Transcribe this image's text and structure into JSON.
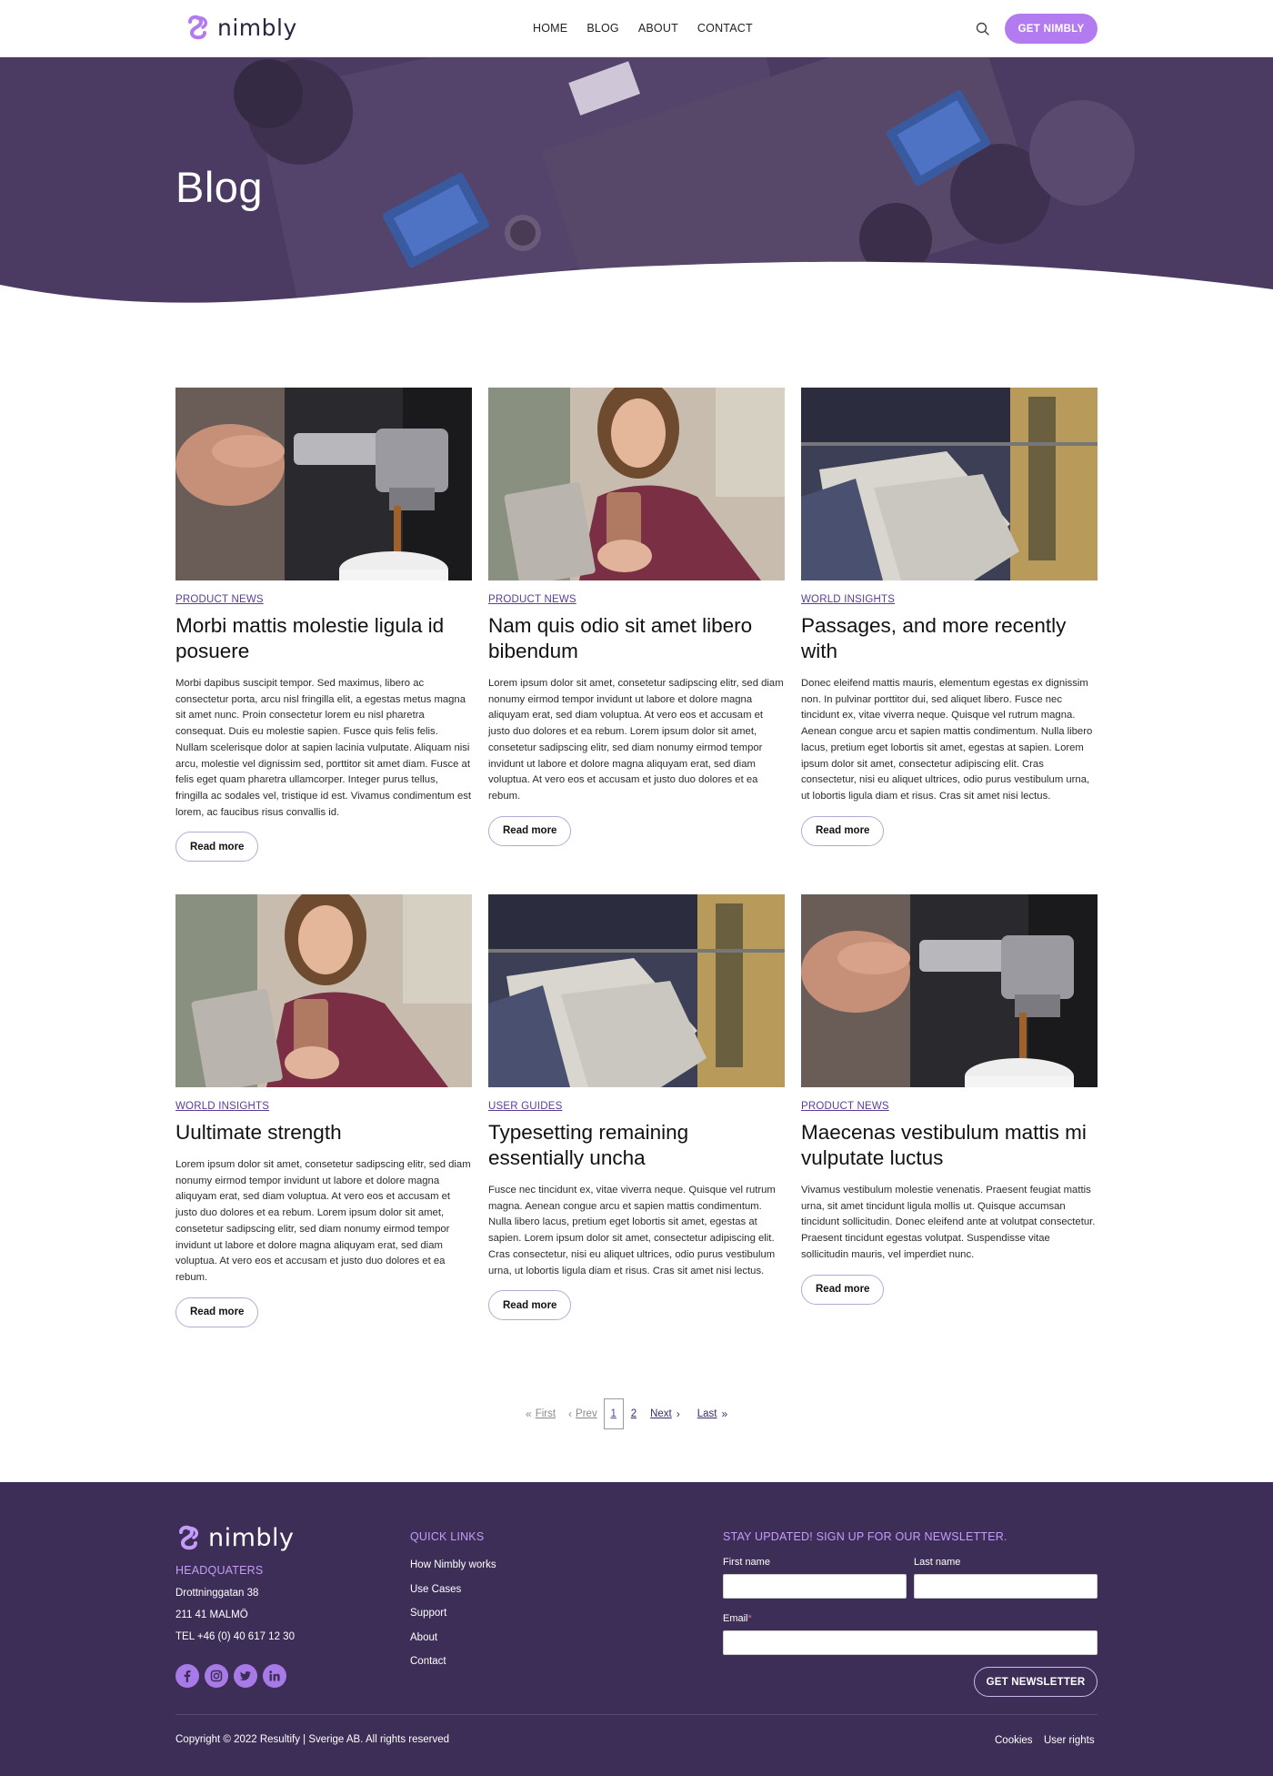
{
  "header": {
    "logo_text": "nimbly",
    "nav": [
      "HOME",
      "BLOG",
      "ABOUT",
      "CONTACT"
    ],
    "cta_label": "GET NIMBLY"
  },
  "hero": {
    "title": "Blog"
  },
  "posts": [
    {
      "category": "PRODUCT NEWS",
      "title": "Morbi mattis molestie ligula id posuere",
      "body": "Morbi dapibus suscipit tempor. Sed maximus, libero ac consectetur porta, arcu nisl fringilla elit, a egestas metus magna sit amet nunc. Proin consectetur lorem eu nisl pharetra consequat. Duis eu molestie sapien. Fusce quis felis felis. Nullam scelerisque dolor at sapien lacinia vulputate. Aliquam nisi arcu, molestie vel dignissim sed, porttitor sit amet diam. Fusce at felis eget quam pharetra ullamcorper. Integer purus tellus, fringilla ac sodales vel, tristique id est. Vivamus condimentum est lorem, ac faucibus risus convallis id.",
      "read_more": "Read more",
      "image": "espresso"
    },
    {
      "category": "PRODUCT NEWS",
      "title": "Nam quis odio sit amet libero bibendum",
      "body": "Lorem ipsum dolor sit amet, consetetur sadipscing elitr, sed diam nonumy eirmod tempor invidunt ut labore et dolore magna aliquyam erat, sed diam voluptua. At vero eos et accusam et justo duo dolores et ea rebum. Lorem ipsum dolor sit amet, consetetur sadipscing elitr, sed diam nonumy eirmod tempor invidunt ut labore et dolore magna aliquyam erat, sed diam voluptua. At vero eos et accusam et justo duo dolores et ea rebum.",
      "read_more": "Read more",
      "image": "woman-phone"
    },
    {
      "category": "WORLD INSIGHTS",
      "title": "Passages, and more recently with",
      "body": "Donec eleifend mattis mauris, elementum egestas ex dignissim non. In pulvinar porttitor dui, sed aliquet libero. Fusce nec tincidunt ex, vitae viverra neque. Quisque vel rutrum magna. Aenean congue arcu et sapien mattis condimentum. Nulla libero lacus, pretium eget lobortis sit amet, egestas at sapien. Lorem ipsum dolor sit amet, consectetur adipiscing elit. Cras consectetur, nisi eu aliquet ultrices, odio purus vestibulum urna, ut lobortis ligula diam et risus. Cras sit amet nisi lectus.",
      "read_more": "Read more",
      "image": "clothes-rack"
    },
    {
      "category": "WORLD INSIGHTS",
      "title": "Uultimate strength",
      "body": "Lorem ipsum dolor sit amet, consetetur sadipscing elitr, sed diam nonumy eirmod tempor invidunt ut labore et dolore magna aliquyam erat, sed diam voluptua. At vero eos et accusam et justo duo dolores et ea rebum. Lorem ipsum dolor sit amet, consetetur sadipscing elitr, sed diam nonumy eirmod tempor invidunt ut labore et dolore magna aliquyam erat, sed diam voluptua. At vero eos et accusam et justo duo dolores et ea rebum.",
      "read_more": "Read more",
      "image": "woman-phone"
    },
    {
      "category": "USER GUIDES",
      "title": "Typesetting remaining essentially uncha",
      "body": "Fusce nec tincidunt ex, vitae viverra neque. Quisque vel rutrum magna. Aenean congue arcu et sapien mattis condimentum. Nulla libero lacus, pretium eget lobortis sit amet, egestas at sapien. Lorem ipsum dolor sit amet, consectetur adipiscing elit. Cras consectetur, nisi eu aliquet ultrices, odio purus vestibulum urna, ut lobortis ligula diam et risus. Cras sit amet nisi lectus.",
      "read_more": "Read more",
      "image": "clothes-rack"
    },
    {
      "category": "PRODUCT NEWS",
      "title": "Maecenas vestibulum mattis mi vulputate luctus",
      "body": "Vivamus vestibulum molestie venenatis. Praesent feugiat mattis urna, sit amet tincidunt ligula mollis ut. Quisque accumsan tincidunt sollicitudin. Donec eleifend ante at volutpat consectetur. Praesent tincidunt egestas volutpat. Suspendisse vitae sollicitudin mauris, vel imperdiet nunc.",
      "read_more": "Read more",
      "image": "espresso"
    }
  ],
  "pagination": {
    "first": "First",
    "prev": "Prev",
    "current": "1",
    "page2": "2",
    "next": "Next",
    "last": "Last"
  },
  "footer": {
    "logo_text": "nimbly",
    "hq_heading": "HEADQUATERS",
    "address_line1": "Drottninggatan 38",
    "address_line2": "211 41 MALMÖ",
    "phone": "TEL +46 (0) 40 617 12 30",
    "quick_links_heading": "QUICK LINKS",
    "quick_links": [
      "How Nimbly works",
      "Use Cases",
      "Support",
      "About",
      "Contact"
    ],
    "newsletter_heading": "STAY UPDATED! SIGN UP FOR OUR NEWSLETTER.",
    "first_name_label": "First name",
    "last_name_label": "Last name",
    "email_label": "Email",
    "required_mark": "*",
    "newsletter_button": "GET NEWSLETTER",
    "copyright": "Copyright © 2022 Resultify | Sverige AB. All rights reserved",
    "cookies": "Cookies",
    "user_rights": "User rights",
    "socials": [
      "facebook-icon",
      "instagram-icon",
      "twitter-icon",
      "linkedin-icon"
    ]
  },
  "colors": {
    "accent": "#b27cf0",
    "footer_bg": "#3d2e57",
    "hero_overlay": "#4a3a63",
    "link": "#5b3d97"
  }
}
